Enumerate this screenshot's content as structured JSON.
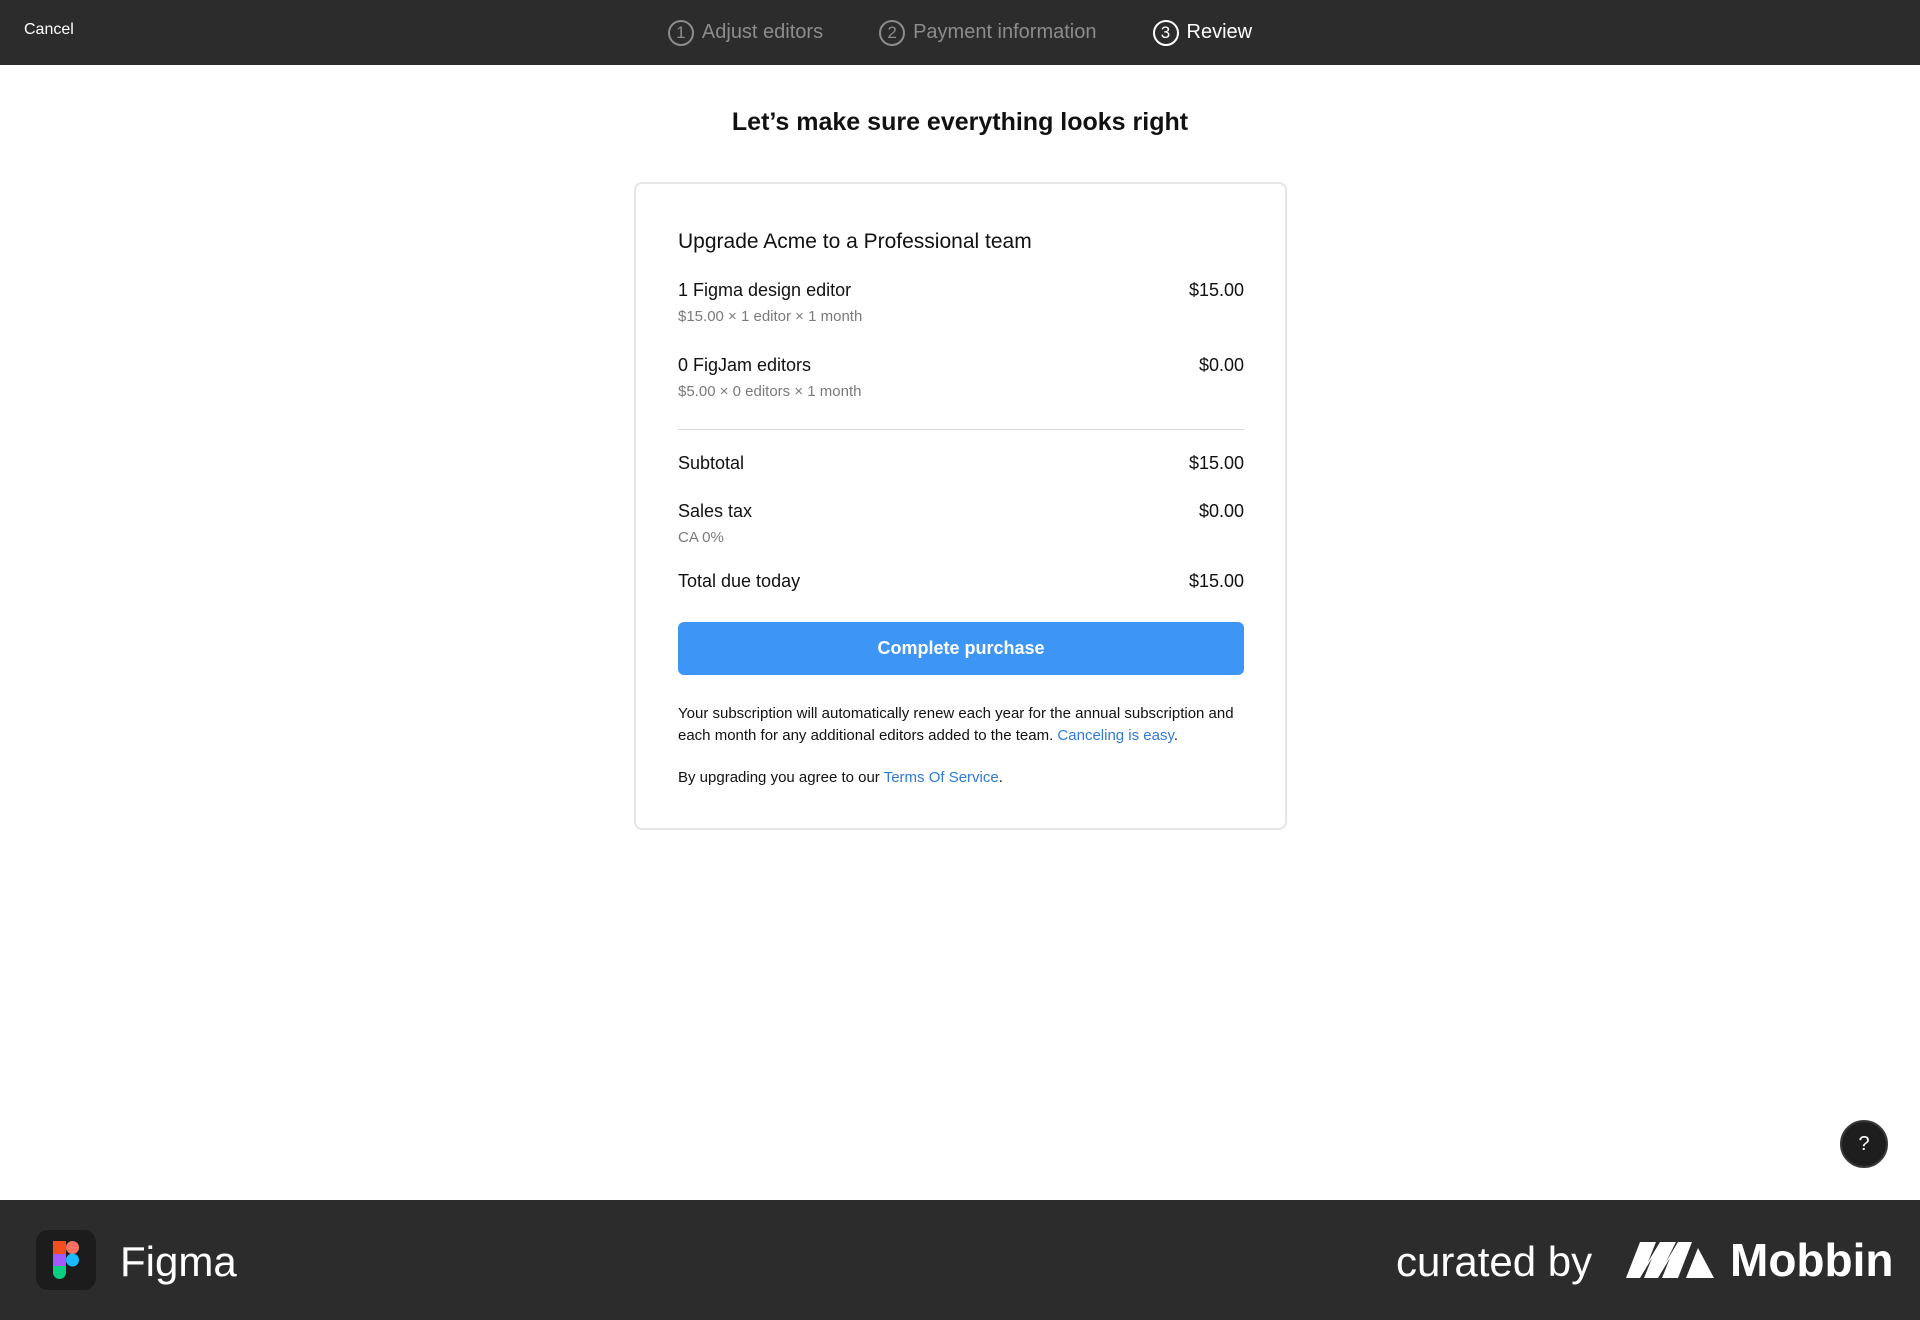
{
  "header": {
    "cancel_label": "Cancel",
    "steps": [
      {
        "number": "1",
        "label": "Adjust editors",
        "active": false
      },
      {
        "number": "2",
        "label": "Payment information",
        "active": false
      },
      {
        "number": "3",
        "label": "Review",
        "active": true
      }
    ]
  },
  "main": {
    "heading": "Let’s make sure everything looks right",
    "card_title": "Upgrade Acme to a Professional team",
    "items": [
      {
        "label": "1 Figma design editor",
        "amount": "$15.00",
        "detail": "$15.00 × 1 editor × 1 month"
      },
      {
        "label": "0 FigJam editors",
        "amount": "$0.00",
        "detail": "$5.00 × 0 editors × 1 month"
      }
    ],
    "subtotal": {
      "label": "Subtotal",
      "amount": "$15.00"
    },
    "sales_tax": {
      "label": "Sales tax",
      "amount": "$0.00",
      "detail": "CA 0%"
    },
    "total": {
      "label": "Total due today",
      "amount": "$15.00"
    },
    "purchase_button": "Complete purchase",
    "renewal_text": "Your subscription will automatically renew each year for the annual subscription and each month for any additional editors added to the team. ",
    "renewal_link": "Canceling is easy",
    "renewal_end": ".",
    "terms_text": "By upgrading you agree to our ",
    "terms_link": "Terms Of Service",
    "terms_end": "."
  },
  "help": {
    "label": "?"
  },
  "footer": {
    "app_name": "Figma",
    "curated_by": "curated by",
    "brand": "Mobbin"
  },
  "colors": {
    "topbar": "#2c2c2c",
    "accent_button": "#3d96f5",
    "link": "#2f7bd8"
  }
}
